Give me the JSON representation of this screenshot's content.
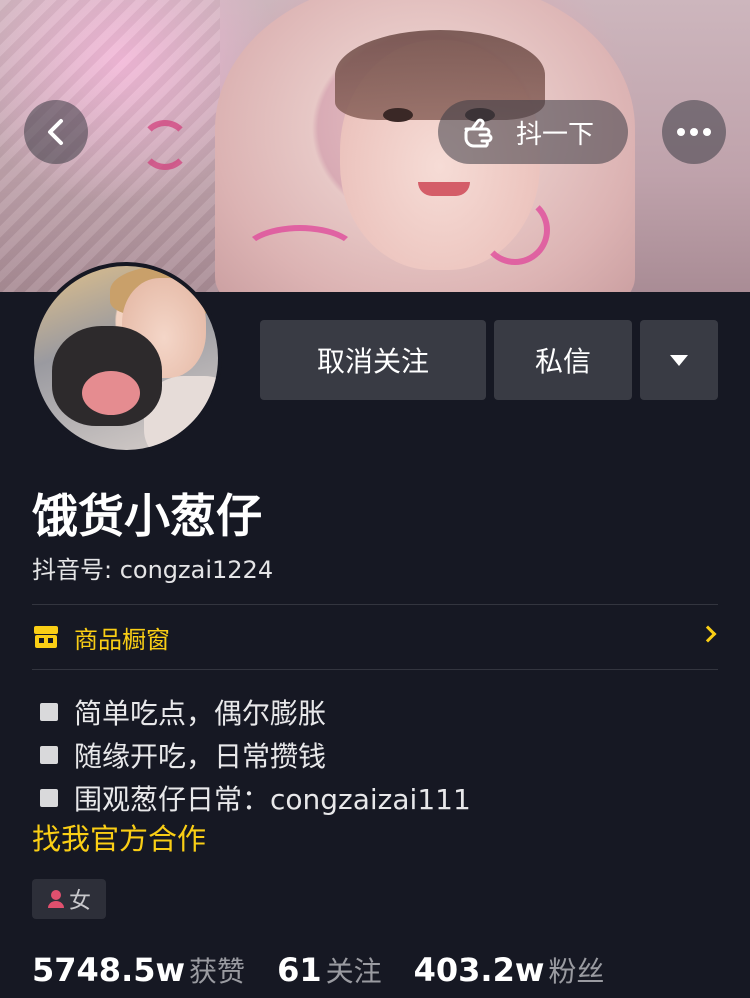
{
  "header": {
    "shake_label": "抖一下"
  },
  "actions": {
    "unfollow_label": "取消关注",
    "message_label": "私信"
  },
  "profile": {
    "name": "饿货小葱仔",
    "douyin_id": "抖音号: congzai1224"
  },
  "shop": {
    "label": "商品橱窗"
  },
  "bio": [
    "简单吃点，偶尔膨胀",
    "随缘开吃，日常攒钱",
    "围观葱仔日常：congzaizai111"
  ],
  "collab_link": "找我官方合作",
  "gender": {
    "label": "女",
    "icon": "female-user-icon",
    "color": "#e0506e"
  },
  "stats": [
    {
      "value": "5748.5w",
      "label": "获赞"
    },
    {
      "value": "61",
      "label": "关注"
    },
    {
      "value": "403.2w",
      "label": "粉丝"
    }
  ],
  "colors": {
    "background": "#161823",
    "accent_yellow": "#face15",
    "button_gray": "#393b44"
  }
}
